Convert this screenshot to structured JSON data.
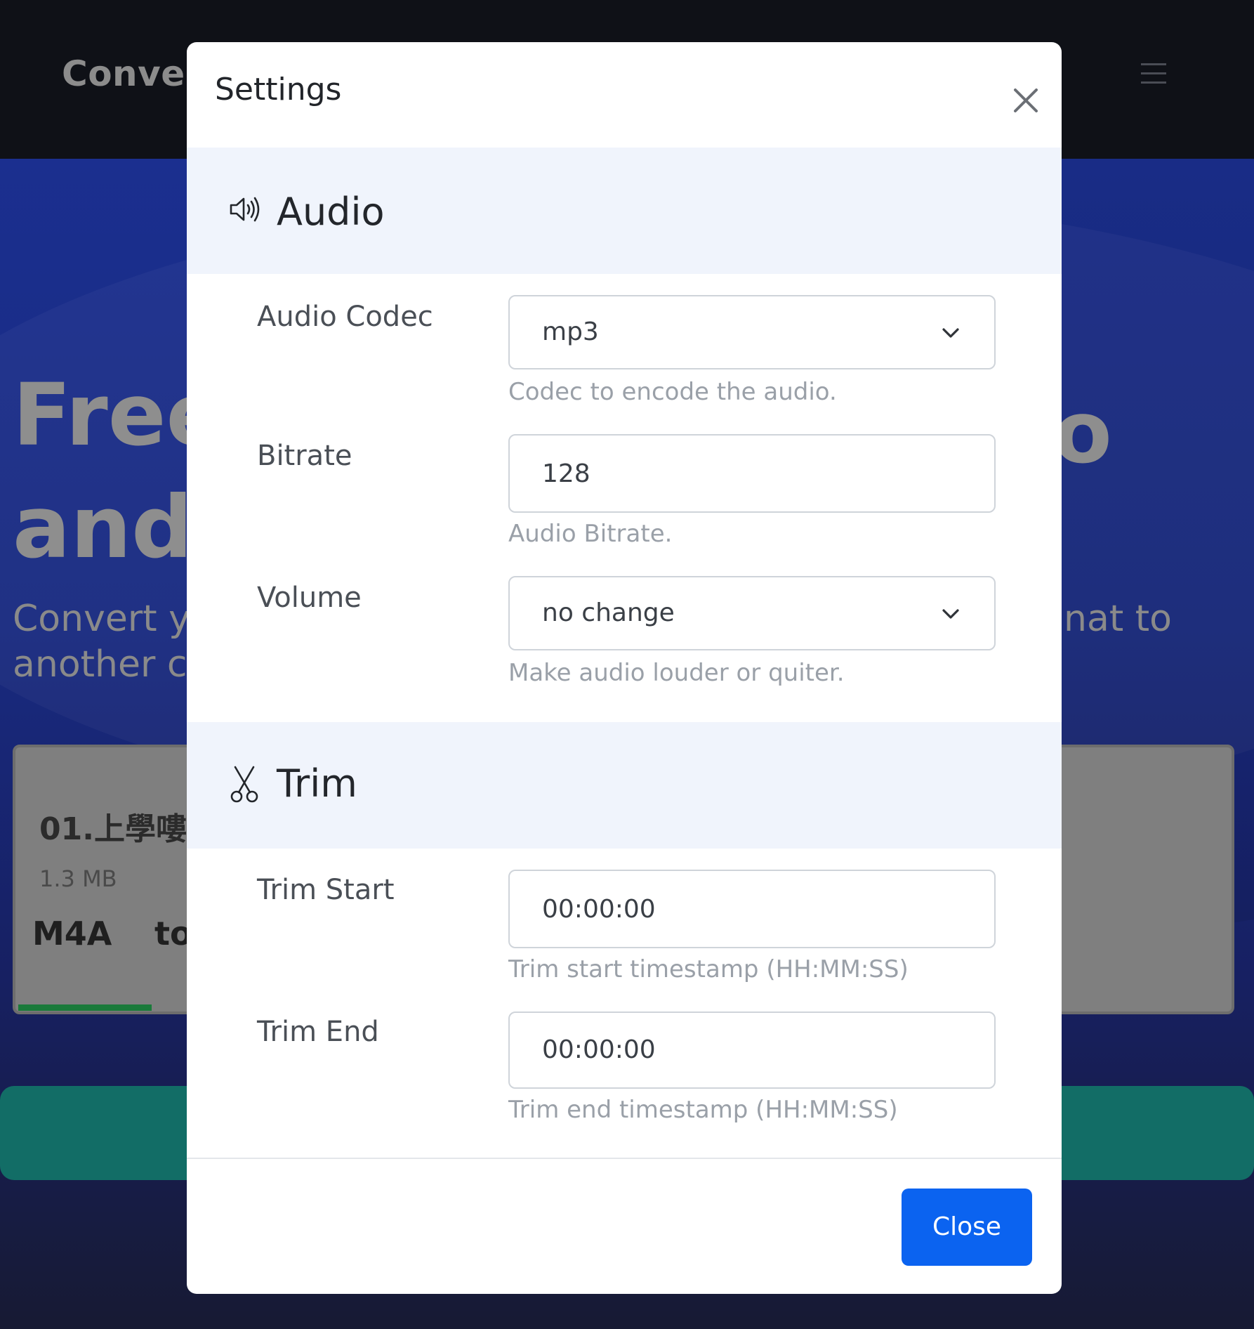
{
  "background": {
    "brand": "Convert",
    "hero_line1": "Free",
    "hero_line2": "and",
    "hero_right": "o",
    "subtitle_line1": "Convert y",
    "subtitle_line2": "another c",
    "subtitle_right": "nat to",
    "file": {
      "name": "01.上學嘍",
      "size": "1.3 MB",
      "from_format": "M4A",
      "to_label": "to",
      "progress_fraction": 0.11
    }
  },
  "modal": {
    "title": "Settings",
    "close_icon": "close-icon",
    "audio_section": {
      "title": "Audio",
      "icon": "speaker-icon",
      "fields": {
        "codec": {
          "label": "Audio Codec",
          "value": "mp3",
          "help": "Codec to encode the audio."
        },
        "bitrate": {
          "label": "Bitrate",
          "value": "128",
          "help": "Audio Bitrate."
        },
        "volume": {
          "label": "Volume",
          "value": "no change",
          "help": "Make audio louder or quiter."
        }
      }
    },
    "trim_section": {
      "title": "Trim",
      "icon": "scissors-icon",
      "fields": {
        "start": {
          "label": "Trim Start",
          "value": "00:00:00",
          "help": "Trim start timestamp (HH:MM:SS)"
        },
        "end": {
          "label": "Trim End",
          "value": "00:00:00",
          "help": "Trim end timestamp (HH:MM:SS)"
        }
      }
    },
    "footer": {
      "close_label": "Close"
    }
  },
  "colors": {
    "primary_button": "#0b63f0",
    "section_header_bg": "#f0f4fc",
    "help_text": "#9aa0a8"
  }
}
